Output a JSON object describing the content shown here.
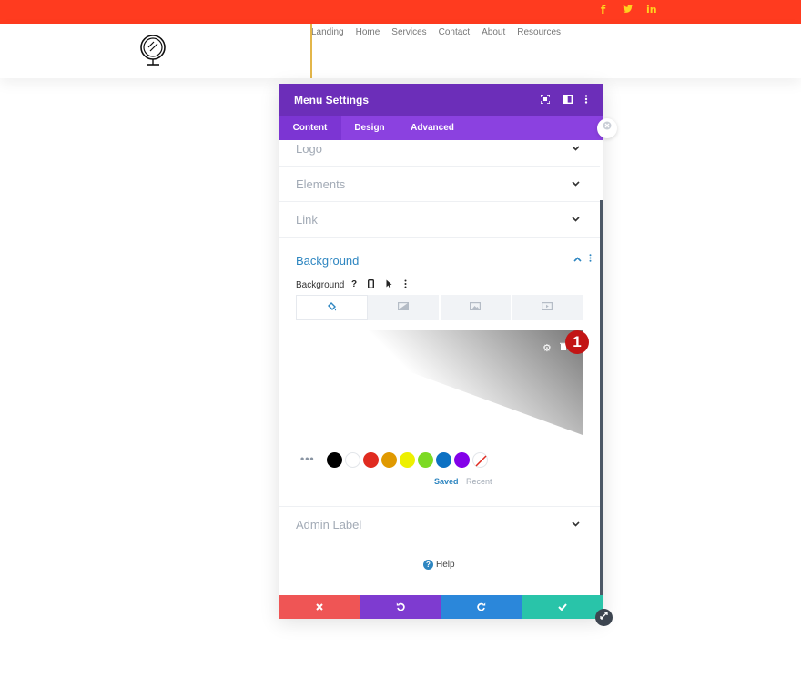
{
  "top_bar": {
    "color": "#ff3b1f",
    "social": [
      {
        "icon": "facebook-icon",
        "glyph": "f"
      },
      {
        "icon": "twitter-icon",
        "glyph": "🐦"
      },
      {
        "icon": "linkedin-icon",
        "glyph": "in"
      }
    ]
  },
  "nav": {
    "items": [
      "Landing",
      "Home",
      "Services",
      "Contact",
      "About",
      "Resources"
    ]
  },
  "modal": {
    "title": "Menu Settings",
    "header_icons": [
      "fullscreen-icon",
      "split-view-icon",
      "more-options-icon"
    ],
    "tabs": [
      "Content",
      "Design",
      "Advanced"
    ],
    "active_tab": "Content",
    "sections": [
      "Logo",
      "Elements",
      "Link"
    ],
    "background": {
      "title": "Background",
      "label": "Background",
      "label_icons": [
        "help-icon",
        "mobile-icon",
        "hover-icon",
        "options-icon"
      ],
      "tabs": [
        "color-fill-icon",
        "gradient-icon",
        "image-icon",
        "video-icon"
      ],
      "badge": "1",
      "swatches": [
        "#000000",
        "#ffffff",
        "#e02b20",
        "#e09900",
        "#edf000",
        "#7cda24",
        "#0c71c3",
        "#8300e9",
        "none"
      ],
      "saved_label": "Saved",
      "recent_label": "Recent"
    },
    "admin_label": "Admin Label",
    "help_label": "Help",
    "footer": {
      "cancel_color": "#ef5555",
      "undo_color": "#7e3bd0",
      "redo_color": "#2b87da",
      "save_color": "#29c4a9"
    }
  }
}
